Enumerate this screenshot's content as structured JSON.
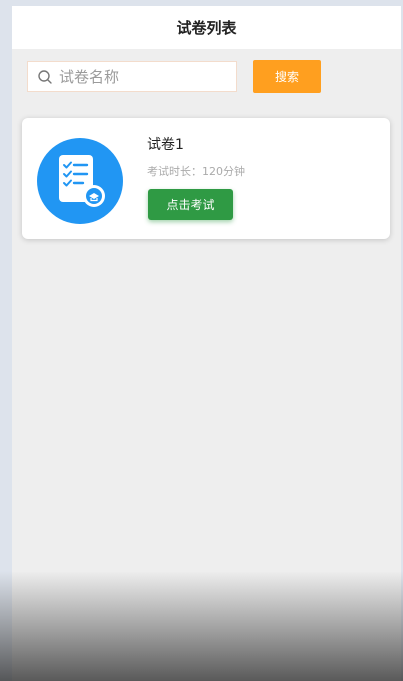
{
  "header": {
    "title": "试卷列表"
  },
  "search": {
    "placeholder": "试卷名称",
    "value": "",
    "button_label": "搜索"
  },
  "exams": [
    {
      "name": "试卷1",
      "duration_label": "考试时长：120分钟",
      "action_label": "点击考试"
    }
  ],
  "colors": {
    "accent_orange": "#ff9f1f",
    "action_green": "#2f9a44",
    "icon_blue": "#2196f3"
  }
}
